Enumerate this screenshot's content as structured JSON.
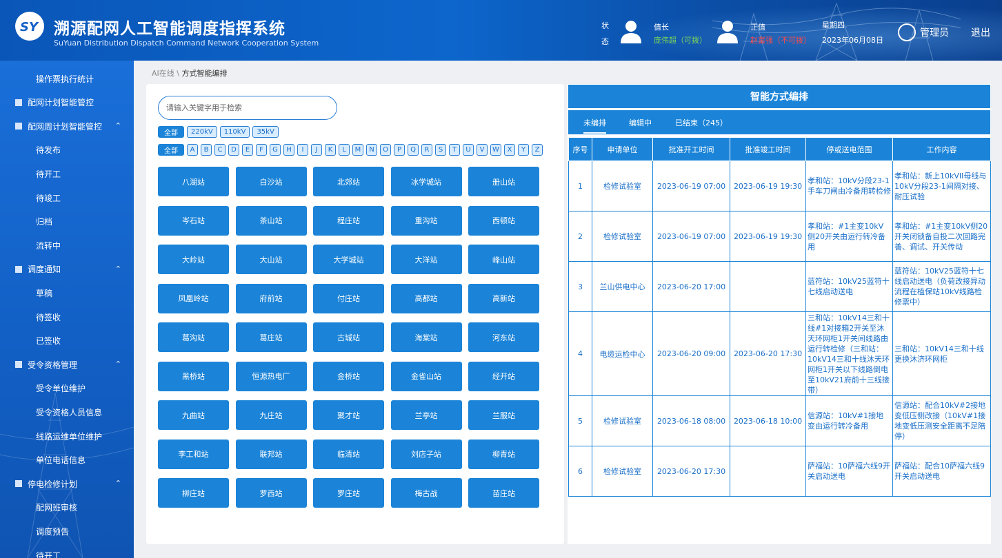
{
  "header": {
    "title": "溯源配网人工智能调度指挥系统",
    "subtitle": "SuYuan Distribution Dispatch Command Network Cooperation System",
    "status_label": "状态",
    "duty1": {
      "role": "值长",
      "name": "庞伟超（可拨）",
      "color": "#7ed957"
    },
    "duty2": {
      "role": "正值",
      "name": "赵富强（不可拨）",
      "color": "#ff4a4a"
    },
    "weekday": "星期四",
    "date": "2023年06月08日",
    "admin": "管理员",
    "logout": "退出"
  },
  "sidebar": {
    "items": [
      {
        "label": "操作票执行统计",
        "type": "sub"
      },
      {
        "label": "配网计划智能管控",
        "type": "group"
      },
      {
        "label": "配网周计划智能管控",
        "type": "group",
        "expanded": true
      },
      {
        "label": "待发布",
        "type": "sub"
      },
      {
        "label": "待开工",
        "type": "sub"
      },
      {
        "label": "待竣工",
        "type": "sub"
      },
      {
        "label": "归档",
        "type": "sub"
      },
      {
        "label": "流转中",
        "type": "sub"
      },
      {
        "label": "调度通知",
        "type": "group",
        "expanded": true
      },
      {
        "label": "草稿",
        "type": "sub"
      },
      {
        "label": "待签收",
        "type": "sub"
      },
      {
        "label": "已签收",
        "type": "sub"
      },
      {
        "label": "受令资格管理",
        "type": "group",
        "expanded": true
      },
      {
        "label": "受令单位维护",
        "type": "sub"
      },
      {
        "label": "受令资格人员信息",
        "type": "sub"
      },
      {
        "label": "线路运维单位维护",
        "type": "sub"
      },
      {
        "label": "单位电话信息",
        "type": "sub"
      },
      {
        "label": "停电检修计划",
        "type": "group",
        "expanded": true
      },
      {
        "label": "配网班审核",
        "type": "sub"
      },
      {
        "label": "调度预告",
        "type": "sub"
      },
      {
        "label": "待开工",
        "type": "sub"
      }
    ]
  },
  "breadcrumb": {
    "parent": "AI在线",
    "sep": "\\",
    "current": "方式智能编排"
  },
  "search": {
    "placeholder": "请输入关键字用于检索",
    "value": ""
  },
  "voltage_filters": [
    "全部",
    "220kV",
    "110kV",
    "35kV"
  ],
  "letter_filters": [
    "全部",
    "A",
    "B",
    "C",
    "D",
    "E",
    "F",
    "G",
    "H",
    "I",
    "J",
    "K",
    "L",
    "M",
    "N",
    "O",
    "P",
    "Q",
    "R",
    "S",
    "T",
    "U",
    "V",
    "W",
    "X",
    "Y",
    "Z"
  ],
  "stations": [
    "八湖站",
    "白沙站",
    "北郊站",
    "冰学城站",
    "册山站",
    "岑石站",
    "茶山站",
    "程庄站",
    "重沟站",
    "西顿站",
    "大岭站",
    "大山站",
    "大学城站",
    "大洋站",
    "峰山站",
    "凤凰岭站",
    "府前站",
    "付庄站",
    "高都站",
    "高新站",
    "葛沟站",
    "葛庄站",
    "古城站",
    "海棠站",
    "河东站",
    "黑桥站",
    "恒源热电厂",
    "金桥站",
    "金雀山站",
    "经开站",
    "九曲站",
    "九庄站",
    "聚才站",
    "兰亭站",
    "兰服站",
    "李工和站",
    "联邦站",
    "临清站",
    "刘店子站",
    "柳青站",
    "柳庄站",
    "罗西站",
    "罗庄站",
    "梅古战",
    "苗庄站"
  ],
  "right_panel": {
    "title": "智能方式编排",
    "tabs": [
      "未编排",
      "编辑中",
      "已结束（245）"
    ],
    "columns": [
      "序号",
      "申请单位",
      "批准开工时间",
      "批准竣工时间",
      "停或送电范围",
      "工作内容"
    ],
    "rows": [
      [
        "1",
        "检修试验室",
        "2023-06-19 07:00",
        "2023-06-19 19:30",
        "孝和站：10kV分段23-1手车刀闸由冷备用转检修",
        "孝和站：新上10kVII母线与10kV分段23-1间隔对接、耐压试验"
      ],
      [
        "2",
        "检修试验室",
        "2023-06-19 07:00",
        "2023-06-19 19:30",
        "孝和站：#1主变10kV侧20开关由运行转冷备用",
        "孝和站：#1主变10kV侧20开关闭锁备自投二次回路完善、调试、开关传动"
      ],
      [
        "3",
        "兰山供电中心",
        "2023-06-20 17:00",
        "",
        "蓝符站：10kV25蓝符十七线启动送电",
        "蓝符站：10kV25蓝符十七线启动送电（负荷改接异动流程在植保站10kV线路检修票中）"
      ],
      [
        "4",
        "电缆运检中心",
        "2023-06-20 09:00",
        "2023-06-20 17:30",
        "三和站：10kV14三和十线#1对接箱2开关至沐天环网柜1开关间线路由运行转检修（三和站：10kV14三和十线沐天环网柜1开关以下线路倒电至10kV21府前十三线接带）",
        "三和站：10kV14三和十线更换沐济环网柜"
      ],
      [
        "5",
        "检修试验室",
        "2023-06-18 08:00",
        "2023-06-18 10:00",
        "信源站：10kV#1接地变由运行转冷备用",
        "信源站：配合10kV#2接地变低压侧改接（10kV#1接地变低压测安全距离不足陪停）"
      ],
      [
        "6",
        "检修试验室",
        "2023-06-20 17:30",
        "",
        "萨福站：10萨福六线9开关启动送电",
        "萨福站：配合10萨福六线9开关启动送电"
      ]
    ]
  }
}
